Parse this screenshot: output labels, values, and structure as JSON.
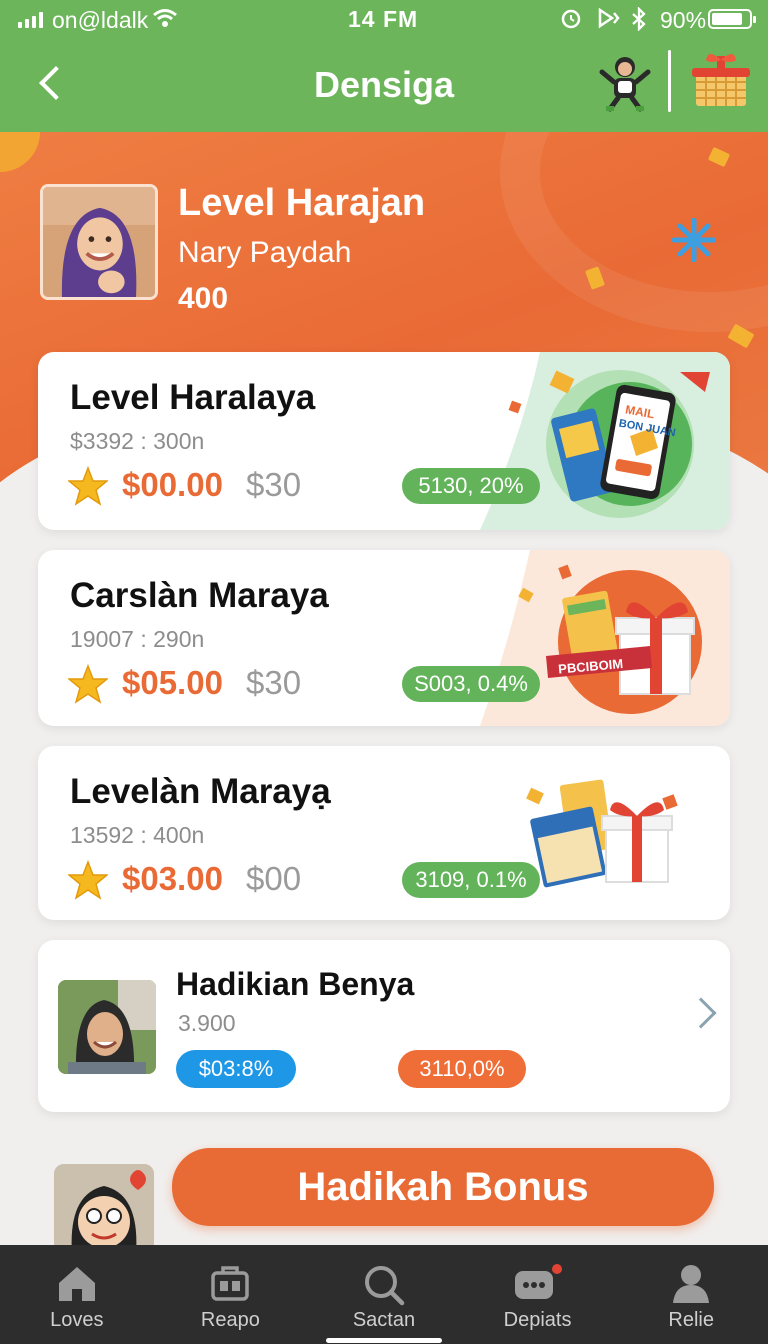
{
  "status_bar": {
    "carrier": "on@ldalk",
    "time": "14 FM",
    "battery": "90%"
  },
  "header": {
    "title": "Densiga"
  },
  "profile": {
    "title": "Level Harajan",
    "name": "Nary Paydah",
    "points": "400"
  },
  "offers": [
    {
      "title": "Level Haralaya",
      "meta": "$3392 : 300n",
      "price": "$00.00",
      "old_price": "$30",
      "badge": "5130, 20%"
    },
    {
      "title": "Carslàn Maraya",
      "meta": "19007 : 290n",
      "price": "$05.00",
      "old_price": "$30",
      "badge": "S003, 0.4%",
      "art_label": "PBCIBOIM"
    },
    {
      "title": "Levelàn Marayạ",
      "meta": "13592 : 400n",
      "price": "$03.00",
      "old_price": "$00",
      "badge": "3109, 0.1%"
    }
  ],
  "featured": {
    "title": "Hadikian Benya",
    "meta": "3.900",
    "pill_blue": "$03:8%",
    "pill_orange": "3110,0%"
  },
  "phone_art": {
    "line1": "MAIL",
    "line2": "BON JUAN"
  },
  "bonus": {
    "label": "Hadikah Bonus"
  },
  "bottom_nav": [
    {
      "label": "Loves",
      "icon": "home-icon"
    },
    {
      "label": "Reapo",
      "icon": "briefcase-icon"
    },
    {
      "label": "Sactan",
      "icon": "search-icon"
    },
    {
      "label": "Depiats",
      "icon": "chat-icon"
    },
    {
      "label": "Relie",
      "icon": "profile-icon"
    }
  ],
  "colors": {
    "primary_green": "#6cb55a",
    "accent_orange": "#e96a35",
    "blue": "#1d97e6"
  }
}
